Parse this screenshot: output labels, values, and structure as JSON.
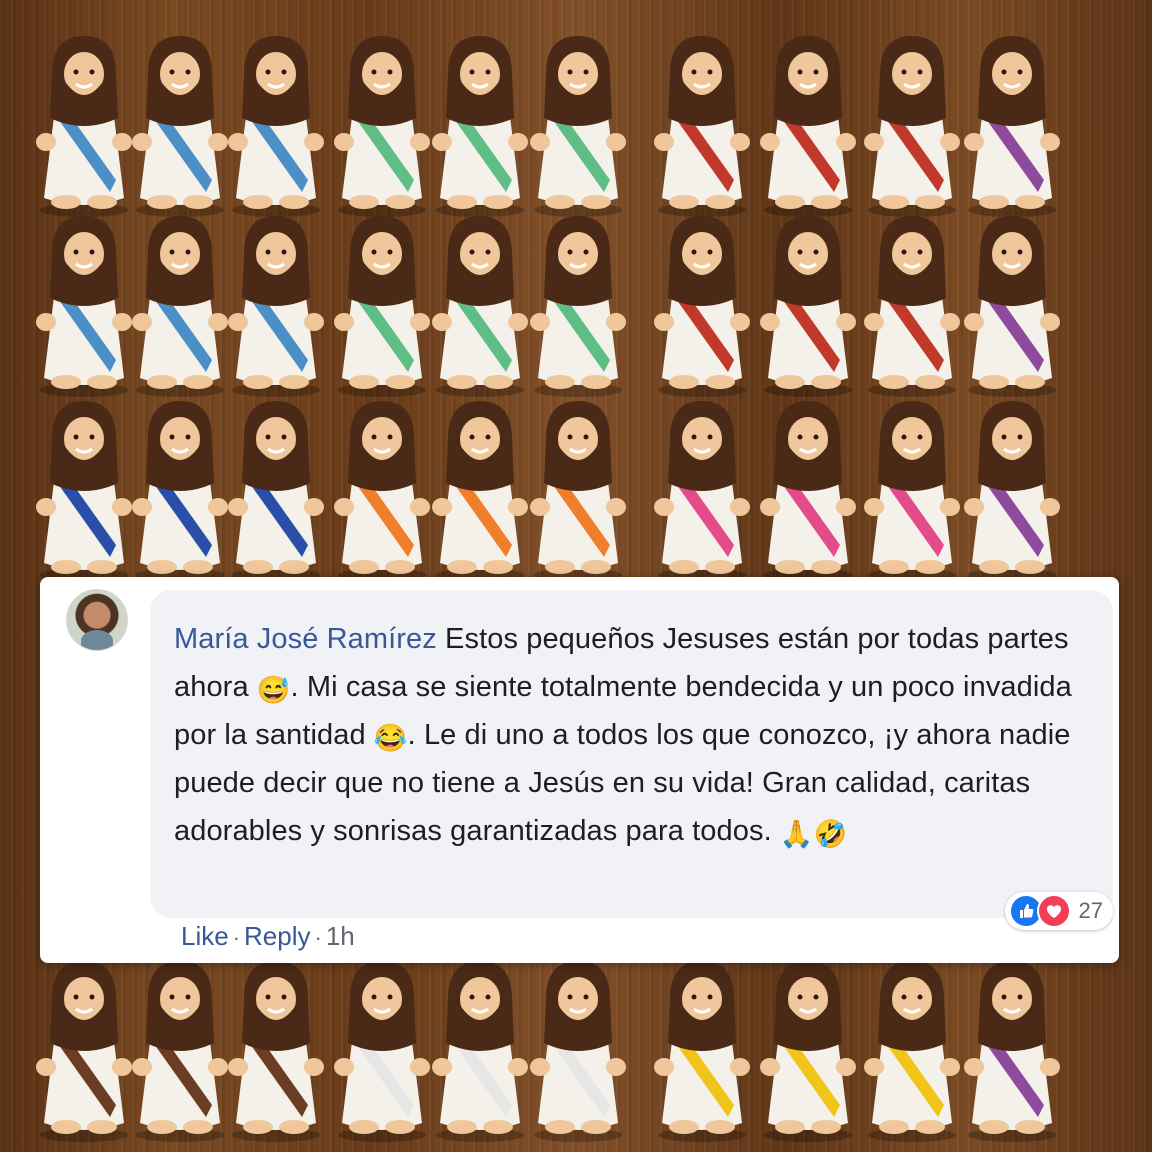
{
  "background": {
    "rows": [
      {
        "sashes": [
          "#4b8fc6",
          "#4b8fc6",
          "#4b8fc6",
          "#5fbd86",
          "#5fbd86",
          "#5fbd86",
          "#c0392b",
          "#c0392b",
          "#c0392b",
          "#8e4a9c"
        ]
      },
      {
        "sashes": [
          "#4b8fc6",
          "#4b8fc6",
          "#4b8fc6",
          "#5fbd86",
          "#5fbd86",
          "#5fbd86",
          "#c0392b",
          "#c0392b",
          "#c0392b",
          "#8e4a9c"
        ]
      },
      {
        "sashes": [
          "#2a4fa8",
          "#2a4fa8",
          "#2a4fa8",
          "#ef7f2a",
          "#ef7f2a",
          "#ef7f2a",
          "#e44b8a",
          "#e44b8a",
          "#e44b8a",
          "#8e4a9c"
        ]
      },
      {
        "sashes": [
          "#6b3d23",
          "#6b3d23",
          "#6b3d23",
          "#e6e6e6",
          "#e6e6e6",
          "#e6e6e6",
          "#f0c419",
          "#f0c419",
          "#f0c419",
          "#8e4a9c"
        ]
      }
    ]
  },
  "comment": {
    "avatar": "avatar",
    "author": "María José Ramírez",
    "segments": {
      "s1": " Estos pequeños Jesuses están por todas partes ahora ",
      "e1": "😅",
      "s2": ". Mi casa se siente totalmente bendecida y un poco invadida por la santidad ",
      "e2": "😂",
      "s3": ". Le di uno a todos los que conozco, ¡y ahora nadie puede decir que no tiene a Jesús en su vida! Gran calidad, caritas adorables y sonrisas garantizadas para todos. ",
      "e3": "🙏",
      "e4": "🤣"
    },
    "reactions": {
      "icons": [
        "like-icon",
        "love-icon"
      ],
      "like_color": "#1877f2",
      "love_color": "#f33e58",
      "count": "27"
    },
    "actions": {
      "like": "Like",
      "separator": "·",
      "reply": "Reply",
      "time": "1h"
    }
  }
}
